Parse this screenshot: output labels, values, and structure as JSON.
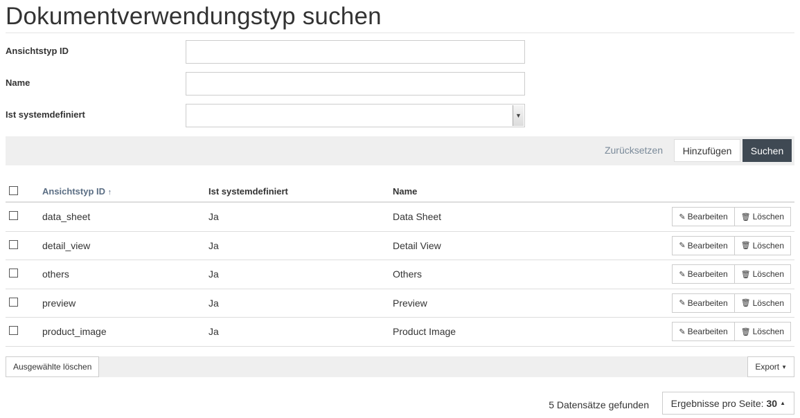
{
  "page": {
    "title": "Dokumentverwendungstyp suchen"
  },
  "form": {
    "view_type_id_label": "Ansichtstyp ID",
    "view_type_id_value": "",
    "name_label": "Name",
    "name_value": "",
    "system_defined_label": "Ist systemdefiniert",
    "system_defined_value": ""
  },
  "actions": {
    "reset": "Zurücksetzen",
    "add": "Hinzufügen",
    "search": "Suchen"
  },
  "table": {
    "headers": {
      "view_type_id": "Ansichtstyp ID",
      "sort_arrow": "↑",
      "system_defined": "Ist systemdefiniert",
      "name": "Name"
    },
    "edit_label": "Bearbeiten",
    "delete_label": "Löschen",
    "rows": [
      {
        "id": "data_sheet",
        "system": "Ja",
        "name": "Data Sheet"
      },
      {
        "id": "detail_view",
        "system": "Ja",
        "name": "Detail View"
      },
      {
        "id": "others",
        "system": "Ja",
        "name": "Others"
      },
      {
        "id": "preview",
        "system": "Ja",
        "name": "Preview"
      },
      {
        "id": "product_image",
        "system": "Ja",
        "name": "Product Image"
      }
    ]
  },
  "bottom": {
    "delete_selected": "Ausgewählte löschen",
    "export": "Export",
    "records_found": "5 Datensätze gefunden",
    "per_page_label": "Ergebnisse pro Seite:",
    "per_page_value": "30"
  },
  "icons": {
    "edit": "pencil-icon",
    "delete": "trash-icon",
    "caret_down": "caret-down-icon",
    "caret_up": "caret-up-icon"
  }
}
